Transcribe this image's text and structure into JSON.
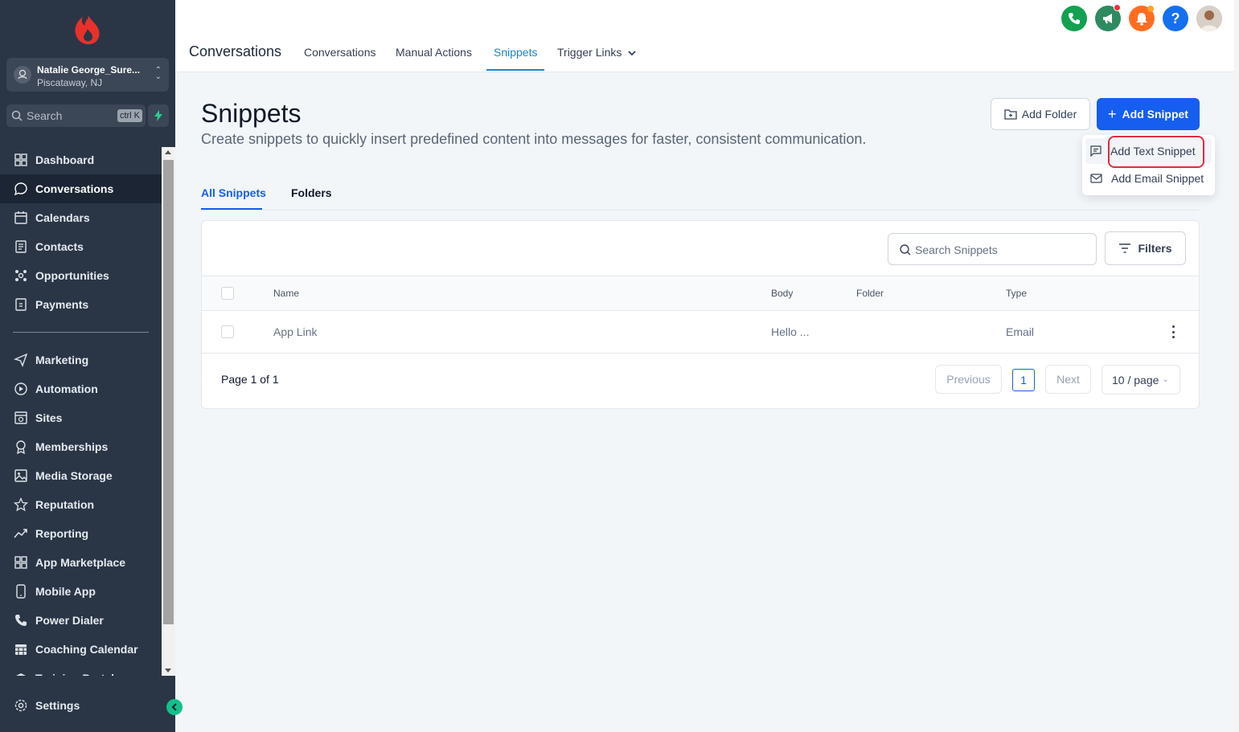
{
  "account": {
    "name": "Natalie George_Sure...",
    "location": "Piscataway, NJ"
  },
  "search": {
    "placeholder": "Search",
    "shortcut": "ctrl K"
  },
  "sidebar": {
    "items": [
      {
        "label": "Dashboard",
        "icon": "dashboard-icon"
      },
      {
        "label": "Conversations",
        "icon": "chat-icon",
        "active": true
      },
      {
        "label": "Calendars",
        "icon": "calendar-icon"
      },
      {
        "label": "Contacts",
        "icon": "contacts-icon"
      },
      {
        "label": "Opportunities",
        "icon": "opportunities-icon"
      },
      {
        "label": "Payments",
        "icon": "payments-icon"
      },
      {
        "label": "Marketing",
        "icon": "send-icon"
      },
      {
        "label": "Automation",
        "icon": "automation-icon"
      },
      {
        "label": "Sites",
        "icon": "sites-icon"
      },
      {
        "label": "Memberships",
        "icon": "award-icon"
      },
      {
        "label": "Media Storage",
        "icon": "image-icon"
      },
      {
        "label": "Reputation",
        "icon": "star-icon"
      },
      {
        "label": "Reporting",
        "icon": "trend-icon"
      },
      {
        "label": "App Marketplace",
        "icon": "apps-icon"
      },
      {
        "label": "Mobile App",
        "icon": "mobile-icon"
      },
      {
        "label": "Power Dialer",
        "icon": "phone-icon"
      },
      {
        "label": "Coaching Calendar",
        "icon": "calendar-grid-icon"
      },
      {
        "label": "Training Portal",
        "icon": "training-icon"
      }
    ],
    "settings_label": "Settings"
  },
  "header": {
    "title": "Conversations",
    "tabs": [
      "Conversations",
      "Manual Actions",
      "Snippets",
      "Trigger Links"
    ],
    "active_tab": "Snippets"
  },
  "page": {
    "title": "Snippets",
    "subtitle": "Create snippets to quickly insert predefined content into messages for faster, consistent communication.",
    "add_folder_label": "Add Folder",
    "add_snippet_label": "Add Snippet",
    "menu": [
      "Add Text Snippet",
      "Add Email Snippet"
    ],
    "tabs": [
      "All Snippets",
      "Folders"
    ],
    "search_placeholder": "Search Snippets",
    "filters_label": "Filters"
  },
  "table": {
    "columns": [
      "Name",
      "Body",
      "Folder",
      "Type"
    ],
    "rows": [
      {
        "name": "App Link",
        "body": "Hello ...",
        "folder": "",
        "type": "Email"
      }
    ]
  },
  "pagination": {
    "info": "Page 1 of 1",
    "previous": "Previous",
    "current": "1",
    "next": "Next",
    "page_size": "10 / page"
  },
  "colors": {
    "primary": "#155eef",
    "sidebar": "#2a3646",
    "highlight": "#e02d3c"
  }
}
